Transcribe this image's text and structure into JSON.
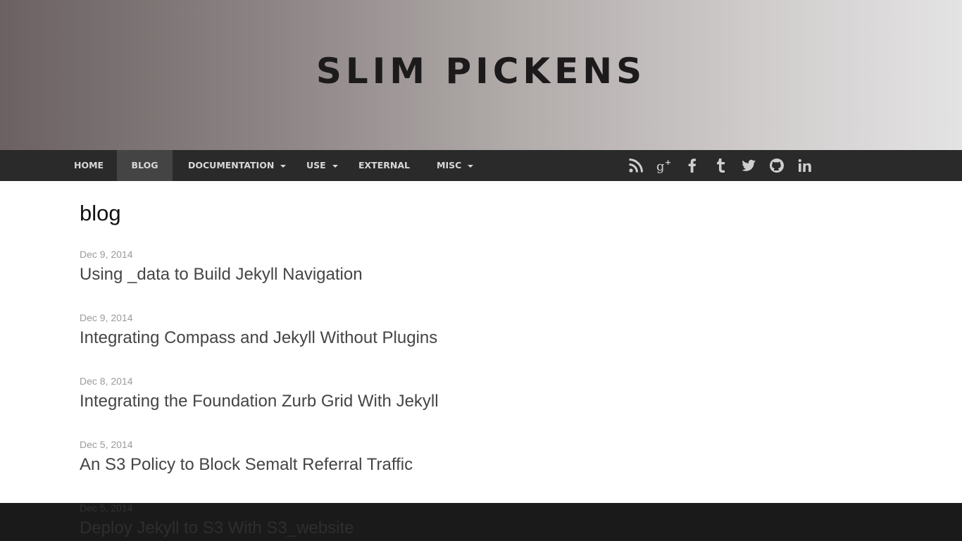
{
  "site": {
    "title": "SLIM PICKENS"
  },
  "nav": {
    "items": [
      {
        "label": "HOME"
      },
      {
        "label": "BLOG"
      },
      {
        "label": "DOCUMENTATION"
      },
      {
        "label": "USE"
      },
      {
        "label": "EXTERNAL"
      },
      {
        "label": "MISC"
      }
    ],
    "social_icons": [
      "rss-icon",
      "google-plus-icon",
      "facebook-icon",
      "tumblr-icon",
      "twitter-icon",
      "github-icon",
      "linkedin-icon"
    ]
  },
  "page": {
    "title": "blog"
  },
  "posts": [
    {
      "date": "Dec 9, 2014",
      "title": "Using _data to Build Jekyll Navigation"
    },
    {
      "date": "Dec 9, 2014",
      "title": "Integrating Compass and Jekyll Without Plugins"
    },
    {
      "date": "Dec 8, 2014",
      "title": "Integrating the Foundation Zurb Grid With Jekyll"
    },
    {
      "date": "Dec 5, 2014",
      "title": "An S3 Policy to Block Semalt Referral Traffic"
    },
    {
      "date": "Dec 5, 2014",
      "title": "Deploy Jekyll to S3 With S3_website"
    }
  ],
  "colors": {
    "navbar": "#2a2a2a",
    "nav_active": "#444444",
    "footer": "#1a1a1a",
    "text_link": "#454545"
  }
}
